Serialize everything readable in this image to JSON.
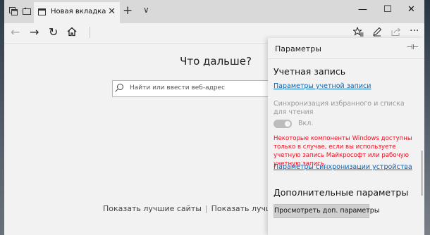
{
  "tab": {
    "title": "Новая вкладка"
  },
  "window_controls": {
    "minimize": "—",
    "maximize": "☐",
    "close": "✕"
  },
  "content": {
    "heading": "Что дальше?",
    "search_placeholder": "Найти или ввести веб-адрес",
    "show_sites_left": "Показать лучшие сайты",
    "show_sites_sep": "|",
    "show_sites_right": "Показать лучшие сайт"
  },
  "settings": {
    "title": "Параметры",
    "account_heading": "Учетная запись",
    "account_link": "Параметры учетной записи",
    "sync_desc": "Синхронизация избранного и списка для чтения",
    "toggle_state": "Вкл.",
    "warning": "Некоторые компоненты Windows доступны только в случае, если вы используете учетную запись Майкрософт или рабочую учетную запись.",
    "sync_link": "Параметры синхронизации устройства",
    "advanced_heading": "Дополнительные параметры",
    "advanced_button": "Просмотреть доп. параметры"
  },
  "colors": {
    "link": "#0b63b5",
    "warning": "#e81123",
    "pane_bg": "#f2f2f2",
    "tabbar_bg": "#d9d9d9"
  }
}
